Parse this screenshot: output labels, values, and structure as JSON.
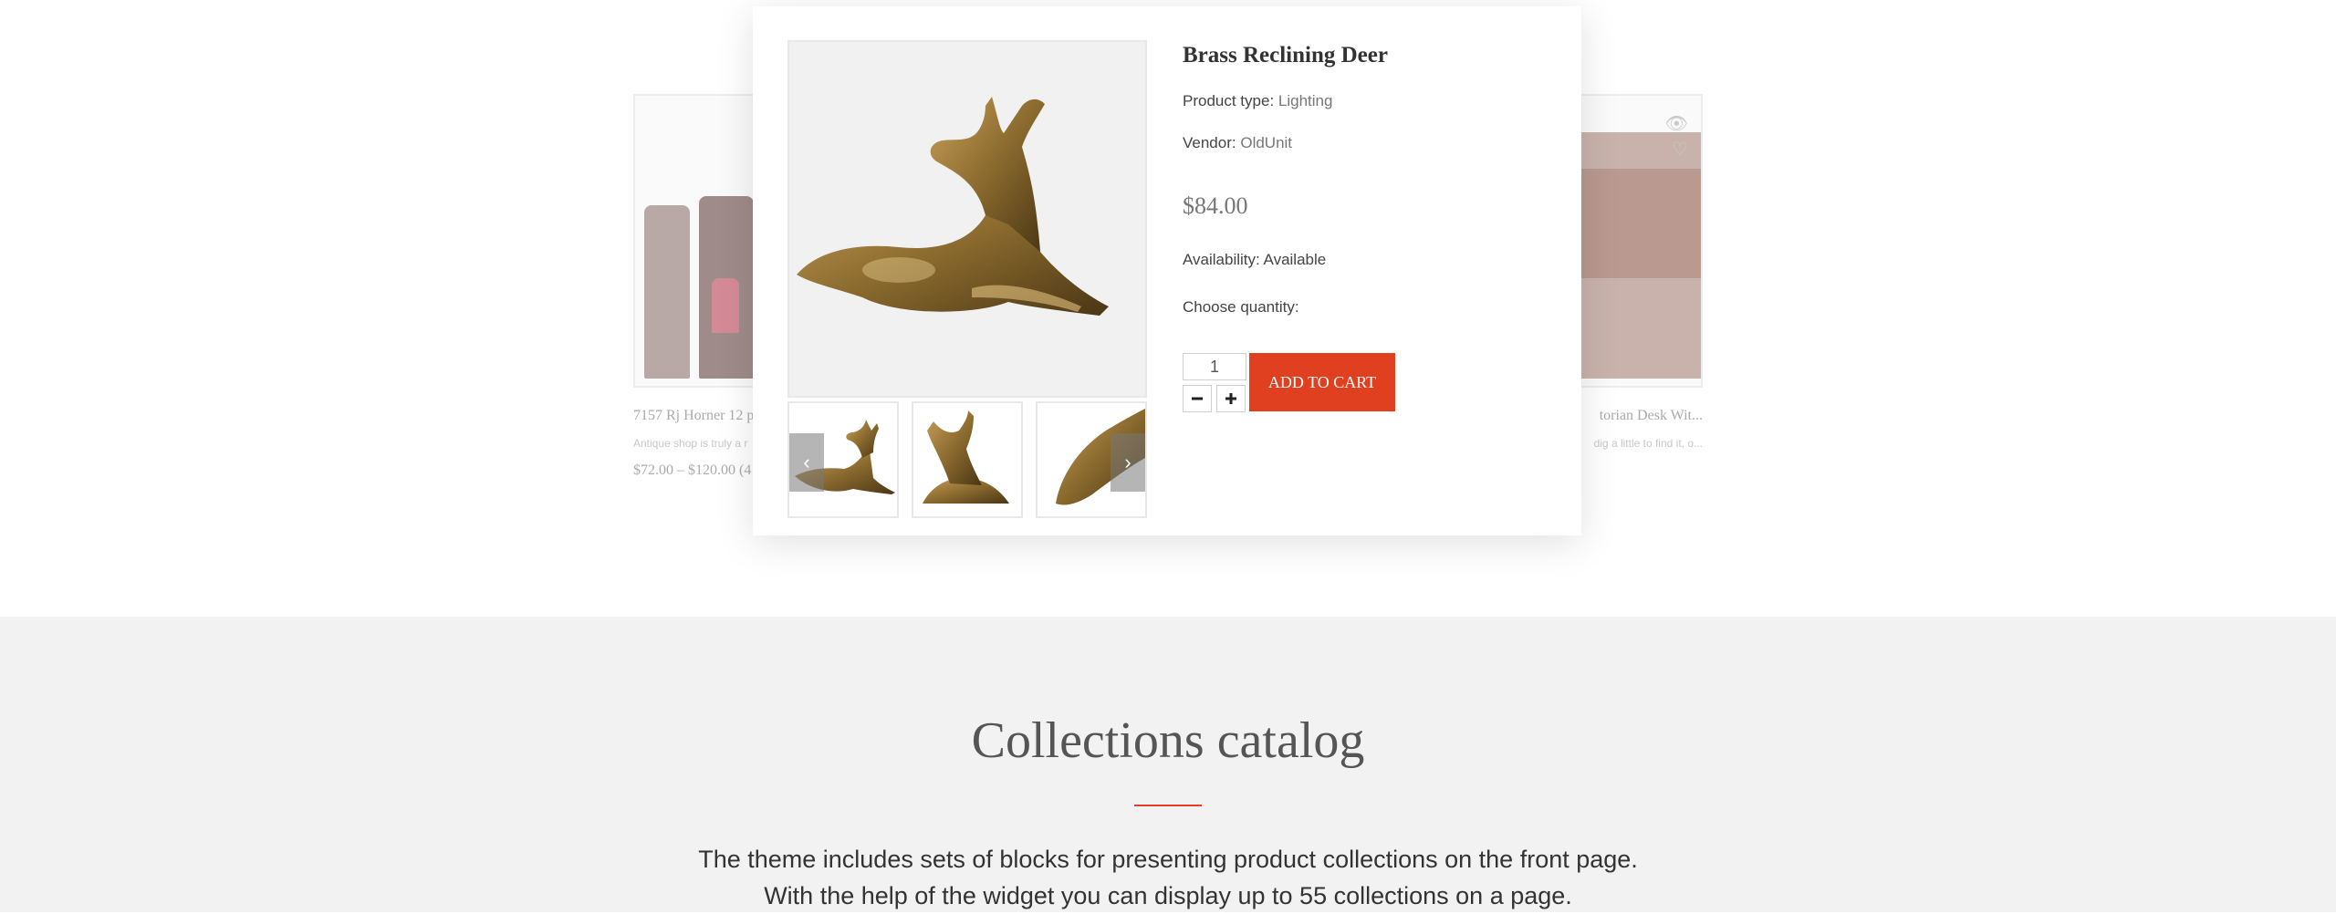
{
  "background_products": {
    "left": {
      "title": "7157 Rj Horner 12 p",
      "desc": "Antique shop is truly a r",
      "price": "$72.00 – $120.00 (4"
    },
    "right": {
      "title": "torian Desk Wit...",
      "desc": "dig a little to find it, o..."
    }
  },
  "modal": {
    "title": "Brass Reclining Deer",
    "product_type_label": "Product type:",
    "product_type_value": "Lighting",
    "vendor_label": "Vendor:",
    "vendor_value": "OldUnit",
    "price": "$84.00",
    "availability_label": "Availability:",
    "availability_value": "Available",
    "quantity_label": "Choose quantity:",
    "quantity_value": "1",
    "add_to_cart": "ADD TO CART",
    "prev_arrow": "‹",
    "next_arrow": "›"
  },
  "collections": {
    "title": "Collections catalog",
    "text_line1": "The theme includes sets of blocks for presenting product collections on the front page.",
    "text_line2": "With the help of the widget you can display up to 55 collections on a page."
  },
  "colors": {
    "accent": "#e0401f",
    "brass": "#8a6a2e",
    "section_bg": "#f2f2f2"
  }
}
